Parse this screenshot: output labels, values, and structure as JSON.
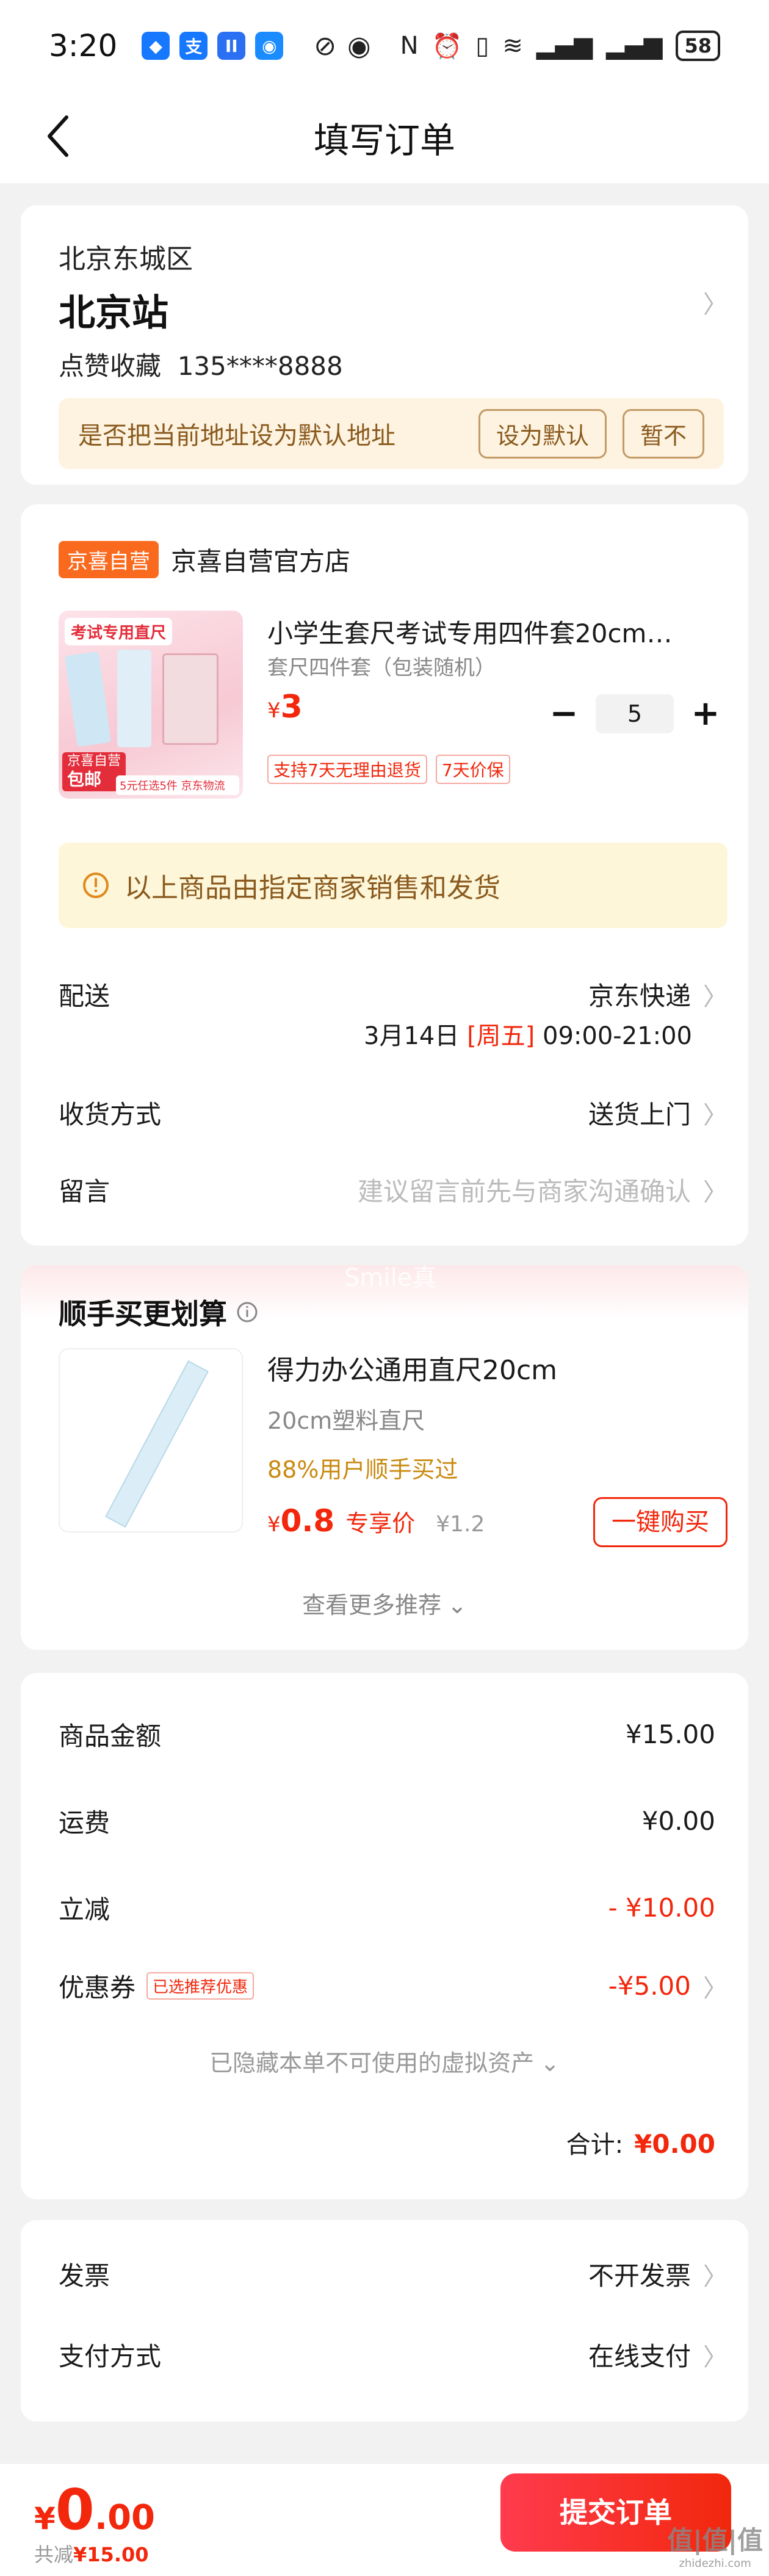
{
  "status": {
    "time": "3:20",
    "apps": [
      {
        "icon": "app-icon-blue",
        "glyph": "◆",
        "color": "#1677ff"
      },
      {
        "icon": "alipay-icon",
        "glyph": "支",
        "color": "#1677ff"
      },
      {
        "icon": "app-icon-ii",
        "glyph": "II",
        "color": "#2b6ff2"
      },
      {
        "icon": "chat-icon",
        "glyph": "◉",
        "color": "#1a8cff"
      }
    ],
    "battery": "58"
  },
  "nav": {
    "title": "填写订单"
  },
  "address": {
    "district": "北京东城区",
    "place": "北京站",
    "contact": "点赞收藏  135****8888",
    "prompt": "是否把当前地址设为默认地址",
    "set_default": "设为默认",
    "not_now": "暂不"
  },
  "store": {
    "badge": "京喜自营",
    "name": "京喜自营官方店",
    "product": {
      "title": "小学生套尺考试专用四件套20cm…",
      "spec": "套尺四件套（包装随机）",
      "currency": "¥",
      "price": "3",
      "qty": "5",
      "tags": [
        "支持7天无理由退货",
        "7天价保"
      ],
      "thumb_title": "考试专用直尺",
      "thumb_badge1": "京喜自营",
      "thumb_badge2": "包邮",
      "thumb_strip": "5元任选5件 京东物流"
    },
    "notice": "以上商品由指定商家销售和发货",
    "delivery_label": "配送",
    "delivery_value": "京东快递",
    "delivery_date": "3月14日",
    "delivery_week": "[周五]",
    "delivery_time": "09:00-21:00",
    "receive_label": "收货方式",
    "receive_value": "送货上门",
    "note_label": "留言",
    "note_placeholder": "建议留言前先与商家沟通确认"
  },
  "addon": {
    "title": "顺手买更划算",
    "watermark": "Smile真",
    "name": "得力办公通用直尺20cm",
    "spec": "20cm塑料直尺",
    "social": "88%用户顺手买过",
    "currency": "¥",
    "price": "0.8",
    "price_tag": "专享价",
    "orig_price": "¥1.2",
    "buy": "一键购买",
    "more": "查看更多推荐"
  },
  "summary": {
    "rows": [
      {
        "label": "商品金额",
        "value": "¥15.00"
      },
      {
        "label": "运费",
        "value": "¥0.00"
      },
      {
        "label": "立减",
        "value": "- ¥10.00"
      }
    ],
    "coupon_label": "优惠券",
    "coupon_tag": "已选推荐优惠",
    "coupon_value": "-¥5.00",
    "hidden_assets": "已隐藏本单不可使用的虚拟资产",
    "total_label": "合计:",
    "total_value": "¥0.00"
  },
  "payment": {
    "invoice_label": "发票",
    "invoice_value": "不开发票",
    "method_label": "支付方式",
    "method_value": "在线支付"
  },
  "bottom": {
    "currency": "¥",
    "int": "0",
    "dec": ".00",
    "saved_label": "共减",
    "saved_value": "¥15.00",
    "submit": "提交订单",
    "wm_top": "值|值|值",
    "wm_bottom": "zhidezhi.com"
  },
  "colors": {
    "brand_red": "#f2270c",
    "accent_orange": "#fa6a1e"
  }
}
